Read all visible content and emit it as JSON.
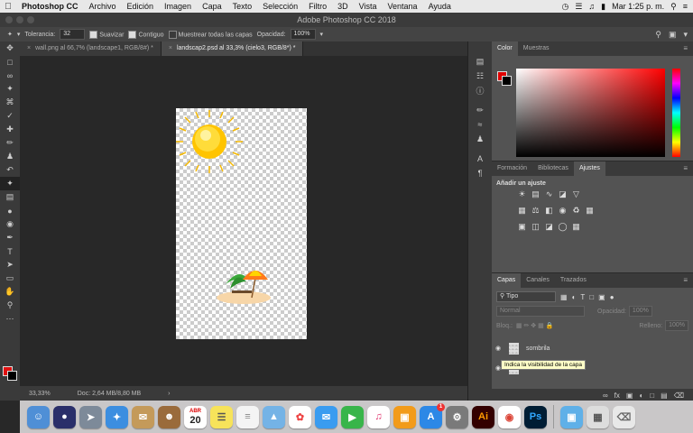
{
  "menubar": {
    "app_name": "Photoshop CC",
    "items": [
      "Archivo",
      "Edición",
      "Imagen",
      "Capa",
      "Texto",
      "Selección",
      "Filtro",
      "3D",
      "Vista",
      "Ventana",
      "Ayuda"
    ],
    "clock": "Mar 1:25 p. m."
  },
  "window_title": "Adobe Photoshop CC 2018",
  "options": {
    "tolerance_label": "Tolerancia:",
    "tolerance_value": "32",
    "smooth_label": "Suavizar",
    "contiguous_label": "Contiguo",
    "sample_all_label": "Muestrear todas las capas",
    "opacity_label": "Opacidad:",
    "opacity_value": "100%"
  },
  "tabs": [
    {
      "label": "wall.png al 66,7% (landscape1, RGB/8#) *"
    },
    {
      "label": "landscap2.psd al 33,3% (cielo3, RGB/8*) *"
    }
  ],
  "status": {
    "zoom": "33,33%",
    "doc_info": "Doc: 2,64 MB/8,80 MB"
  },
  "color_panel": {
    "tabs": [
      "Color",
      "Muestras"
    ],
    "foreground": "#e00000",
    "background": "#000000"
  },
  "adjustments_panel": {
    "tabs": [
      "Formación",
      "Bibliotecas",
      "Ajustes"
    ],
    "title": "Añadir un ajuste"
  },
  "layers_panel": {
    "tabs": [
      "Capas",
      "Canales",
      "Trazados"
    ],
    "filter_kind": "Tipo",
    "blend_mode": "Normal",
    "opacity_label": "Opacidad:",
    "opacity_value": "100%",
    "lock_label": "Bloq.:",
    "fill_label": "Relleno:",
    "fill_value": "100%",
    "layers": [
      {
        "name": "sombrila",
        "visible": true
      },
      {
        "name": "mar2",
        "visible": true
      }
    ],
    "tooltip": "Indica la visibilidad de la capa"
  },
  "dock": {
    "date_badge_month": "ABR",
    "date_badge_day": "20",
    "appstore_badge": "1",
    "app_labels": [
      "Ai",
      "Ps"
    ]
  }
}
